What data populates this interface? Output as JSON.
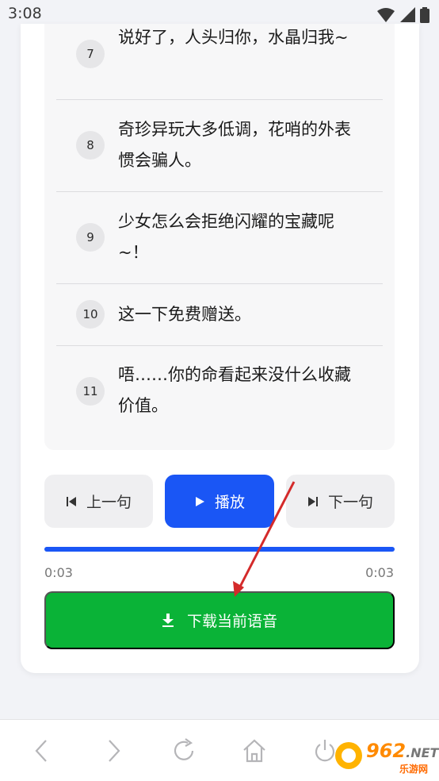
{
  "status_bar": {
    "time": "3:08"
  },
  "lines": [
    {
      "num": "7",
      "text": "说好了，人头归你，水晶归我~"
    },
    {
      "num": "8",
      "text": "奇珍异玩大多低调，花哨的外表惯会骗人。"
    },
    {
      "num": "9",
      "text": "少女怎么会拒绝闪耀的宝藏呢~！"
    },
    {
      "num": "10",
      "text": "这一下免费赠送。"
    },
    {
      "num": "11",
      "text": "唔……你的命看起来没什么收藏价值。"
    }
  ],
  "controls": {
    "prev_label": "上一句",
    "play_label": "播放",
    "next_label": "下一句"
  },
  "player": {
    "current_time": "0:03",
    "total_time": "0:03",
    "progress": 1.0,
    "accent_color": "#1a56f5"
  },
  "download": {
    "label": "下载当前语音",
    "color": "#0ab337"
  },
  "watermark": {
    "brand": "962",
    "tld": ".NET",
    "sub": "乐游网"
  },
  "icons": [
    "wifi-icon",
    "signal-icon",
    "battery-icon",
    "skip-previous-icon",
    "play-icon",
    "skip-next-icon",
    "download-icon",
    "back-icon",
    "forward-icon",
    "refresh-icon",
    "home-icon",
    "power-icon"
  ]
}
